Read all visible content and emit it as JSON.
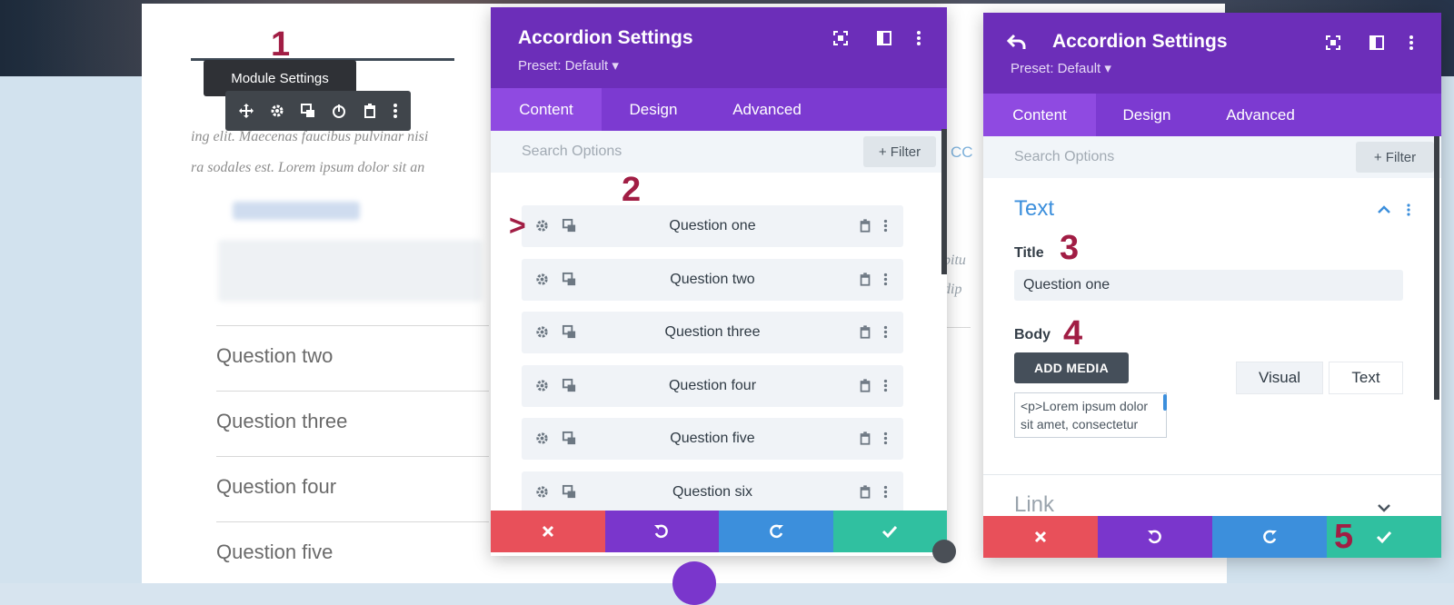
{
  "background": {
    "text_line_1": "ing elit. Maecenas faucibus pulvinar nisi",
    "text_line_2": "ra sodales est. Lorem ipsum dolor sit an",
    "right_fragment_1": "O CC",
    "right_fragment_2": "abitu",
    "right_fragment_3": "adip",
    "questions": [
      "Question two",
      "Question three",
      "Question four",
      "Question five"
    ]
  },
  "module_toolbar": {
    "tooltip": "Module Settings",
    "icons": [
      "move-icon",
      "gear-icon",
      "duplicate-icon",
      "power-icon",
      "trash-icon",
      "more-icon"
    ]
  },
  "steps": [
    "1",
    "2",
    "3",
    "4",
    "5"
  ],
  "arrow_marker": ">",
  "panel_left": {
    "title": "Accordion Settings",
    "preset": "Preset: Default ▾",
    "tabs": [
      "Content",
      "Design",
      "Advanced"
    ],
    "active_tab": "Content",
    "search_placeholder": "Search Options",
    "filter_label": "+ Filter",
    "items": [
      "Question one",
      "Question two",
      "Question three",
      "Question four",
      "Question five",
      "Question six"
    ]
  },
  "panel_right": {
    "title": "Accordion Settings",
    "preset": "Preset: Default ▾",
    "tabs": [
      "Content",
      "Design",
      "Advanced"
    ],
    "active_tab": "Content",
    "search_placeholder": "Search Options",
    "filter_label": "+ Filter",
    "section_title": "Text",
    "title_label": "Title",
    "title_value": "Question one",
    "body_label": "Body",
    "add_media": "ADD MEDIA",
    "editor_tabs": [
      "Visual",
      "Text"
    ],
    "body_value": "<p>Lorem ipsum dolor sit amet, consectetur adipiscing elit",
    "next_section": "Link"
  },
  "colors": {
    "header_purple": "#6c2eb9",
    "tab_purple": "#7c3ad1",
    "active_tab": "#8f4ae1",
    "cancel_red": "#e8505a",
    "redo_blue": "#3c8fdc",
    "save_green": "#30c0a0",
    "step_marker": "#a11d44"
  }
}
